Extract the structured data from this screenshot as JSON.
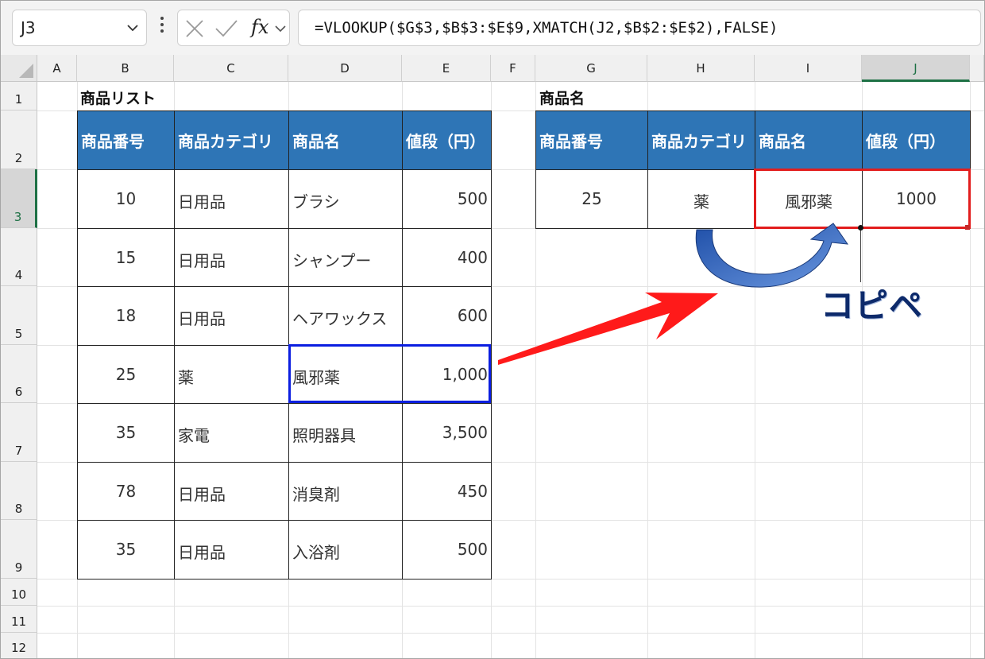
{
  "formula_bar": {
    "name_box": "J3",
    "formula": "=VLOOKUP($G$3,$B$3:$E$9,XMATCH(J2,$B$2:$E$2),FALSE)",
    "fx_label": "fx"
  },
  "columns": [
    "A",
    "B",
    "C",
    "D",
    "E",
    "F",
    "G",
    "H",
    "I",
    "J"
  ],
  "rows": [
    "1",
    "2",
    "3",
    "4",
    "5",
    "6",
    "7",
    "8",
    "9",
    "10",
    "11",
    "12"
  ],
  "left_table": {
    "title": "商品リスト",
    "headers": [
      "商品番号",
      "商品カテゴリ",
      "商品名",
      "値段（円）"
    ],
    "rows": [
      [
        "10",
        "日用品",
        "ブラシ",
        "500"
      ],
      [
        "15",
        "日用品",
        "シャンプー",
        "400"
      ],
      [
        "18",
        "日用品",
        "ヘアワックス",
        "600"
      ],
      [
        "25",
        "薬",
        "風邪薬",
        "1,000"
      ],
      [
        "35",
        "家電",
        "照明器具",
        "3,500"
      ],
      [
        "78",
        "日用品",
        "消臭剤",
        "450"
      ],
      [
        "35",
        "日用品",
        "入浴剤",
        "500"
      ]
    ]
  },
  "right_table": {
    "title": "商品名",
    "headers": [
      "商品番号",
      "商品カテゴリ",
      "商品名",
      "値段（円）"
    ],
    "row": [
      "25",
      "薬",
      "風邪薬",
      "1000"
    ]
  },
  "annotation": {
    "copy_label": "コピペ",
    "red_arrow_color": "#ff1a1a",
    "blue_arrow_color": "#3e6fc9"
  },
  "colors": {
    "header_fill": "#2e75b6",
    "selection_green": "#1e7145",
    "highlight_blue": "#0b1ee0",
    "highlight_red": "#e21d1d"
  }
}
